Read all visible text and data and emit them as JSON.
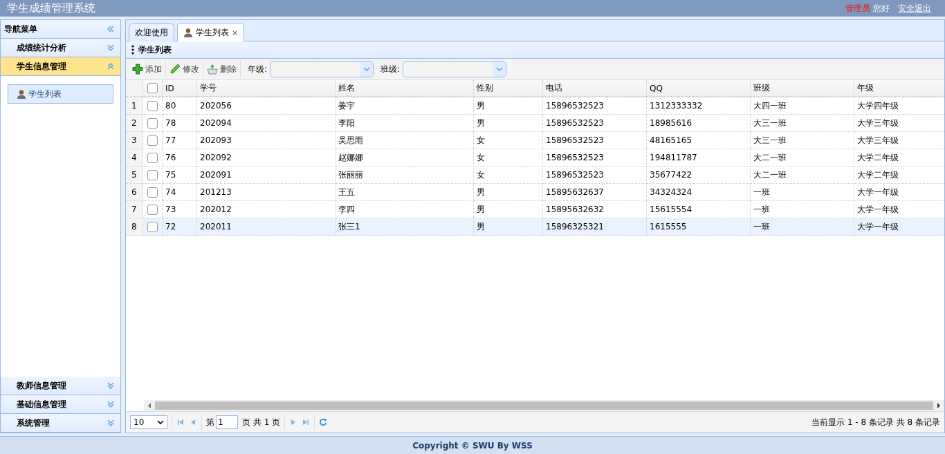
{
  "header": {
    "title": "学生成绩管理系统",
    "user_role": "管理员",
    "greeting": "您好",
    "logout": "安全退出"
  },
  "sidebar": {
    "title": "导航菜单",
    "sections": [
      {
        "label": "成绩统计分析",
        "expanded": false,
        "selected": false
      },
      {
        "label": "学生信息管理",
        "expanded": true,
        "selected": true,
        "items": [
          {
            "label": "学生列表",
            "selected": true
          }
        ]
      },
      {
        "label": "教师信息管理",
        "expanded": false,
        "selected": false
      },
      {
        "label": "基础信息管理",
        "expanded": false,
        "selected": false
      },
      {
        "label": "系统管理",
        "expanded": false,
        "selected": false
      }
    ]
  },
  "tabs": [
    {
      "label": "欢迎使用",
      "selected": false,
      "closable": false
    },
    {
      "label": "学生列表",
      "selected": true,
      "closable": true,
      "close": "×"
    }
  ],
  "panel": {
    "title": "学生列表"
  },
  "toolbar": {
    "buttons": [
      {
        "label": "添加",
        "kind": "add"
      },
      {
        "label": "修改",
        "kind": "edit"
      },
      {
        "label": "删除",
        "kind": "delete"
      }
    ],
    "filters": [
      {
        "label": "年级:"
      },
      {
        "label": "班级:"
      }
    ]
  },
  "table": {
    "select_all_checked": false,
    "columns": [
      "ID",
      "学号",
      "姓名",
      "性别",
      "电话",
      "QQ",
      "班级",
      "年级"
    ],
    "rows": [
      {
        "number": "1",
        "checked": false,
        "selected": false,
        "cells": [
          "80",
          "202056",
          "姜宇",
          "男",
          "15896532523",
          "1312333332",
          "大四一班",
          "大学四年级"
        ]
      },
      {
        "number": "2",
        "checked": false,
        "selected": false,
        "cells": [
          "78",
          "202094",
          "李阳",
          "男",
          "15896532523",
          "18985616",
          "大三一班",
          "大学三年级"
        ]
      },
      {
        "number": "3",
        "checked": false,
        "selected": false,
        "cells": [
          "77",
          "202093",
          "吴思雨",
          "女",
          "15896532523",
          "48165165",
          "大三一班",
          "大学三年级"
        ]
      },
      {
        "number": "4",
        "checked": false,
        "selected": false,
        "cells": [
          "76",
          "202092",
          "赵娜娜",
          "女",
          "15896532523",
          "194811787",
          "大二一班",
          "大学二年级"
        ]
      },
      {
        "number": "5",
        "checked": false,
        "selected": false,
        "cells": [
          "75",
          "202091",
          "张丽丽",
          "女",
          "15896532523",
          "35677422",
          "大二一班",
          "大学二年级"
        ]
      },
      {
        "number": "6",
        "checked": false,
        "selected": false,
        "cells": [
          "74",
          "201213",
          "王五",
          "男",
          "15895632637",
          "34324324",
          "一班",
          "大学一年级"
        ]
      },
      {
        "number": "7",
        "checked": false,
        "selected": false,
        "cells": [
          "73",
          "202012",
          "李四",
          "男",
          "15895632632",
          "15615554",
          "一班",
          "大学一年级"
        ]
      },
      {
        "number": "8",
        "checked": false,
        "selected": true,
        "cells": [
          "72",
          "202011",
          "张三1",
          "男",
          "15896325321",
          "1615555",
          "一班",
          "大学一年级"
        ]
      }
    ]
  },
  "pager": {
    "page_size": "10",
    "page_before": "第",
    "page_value": "1",
    "page_after": "页 共 1 页",
    "summary": "当前显示 1 - 8 条记录 共 8 条记录"
  },
  "footer": "Copyright © SWU By WSS"
}
